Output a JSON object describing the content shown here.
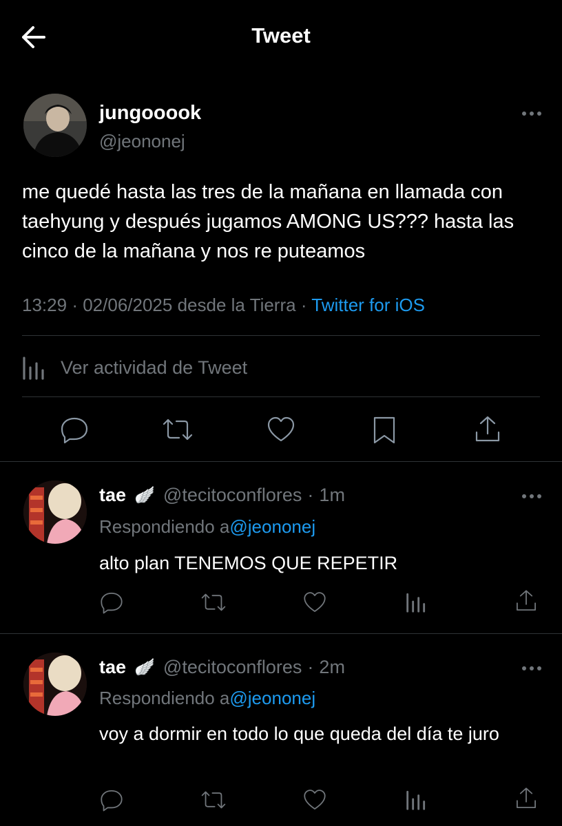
{
  "header": {
    "title": "Tweet"
  },
  "main_tweet": {
    "name": "jungooook",
    "handle": "@jeononej",
    "text": "me quedé hasta las tres de la mañana en llamada con taehyung y después jugamos AMONG US??? hasta las cinco de la mañana y nos re puteamos",
    "time": "13:29",
    "date": "02/06/2025",
    "location": "desde la Tierra",
    "source": "Twitter for iOS",
    "separator": "·",
    "activity_label": "Ver actividad de Tweet"
  },
  "replies": [
    {
      "name": "tae",
      "emoji": "🪽",
      "handle": "@tecitoconflores",
      "time": "1m",
      "replying_label": "Respondiendo a",
      "replying_to": "@jeononej",
      "text": "alto plan TENEMOS QUE REPETIR"
    },
    {
      "name": "tae",
      "emoji": "🪽",
      "handle": "@tecitoconflores",
      "time": "2m",
      "replying_label": "Respondiendo a",
      "replying_to": "@jeononej",
      "text": "voy a dormir en todo lo que queda del día te juro"
    }
  ],
  "icons": {
    "back": "arrow-left-icon",
    "more": "more-icon",
    "activity": "analytics-icon",
    "reply": "reply-icon",
    "retweet": "retweet-icon",
    "like": "heart-icon",
    "bookmark": "bookmark-icon",
    "share": "share-icon"
  },
  "colors": {
    "background": "#000000",
    "text": "#e7e9ea",
    "muted": "#71767b",
    "link": "#1d9bf0",
    "divider": "#2f3336"
  }
}
